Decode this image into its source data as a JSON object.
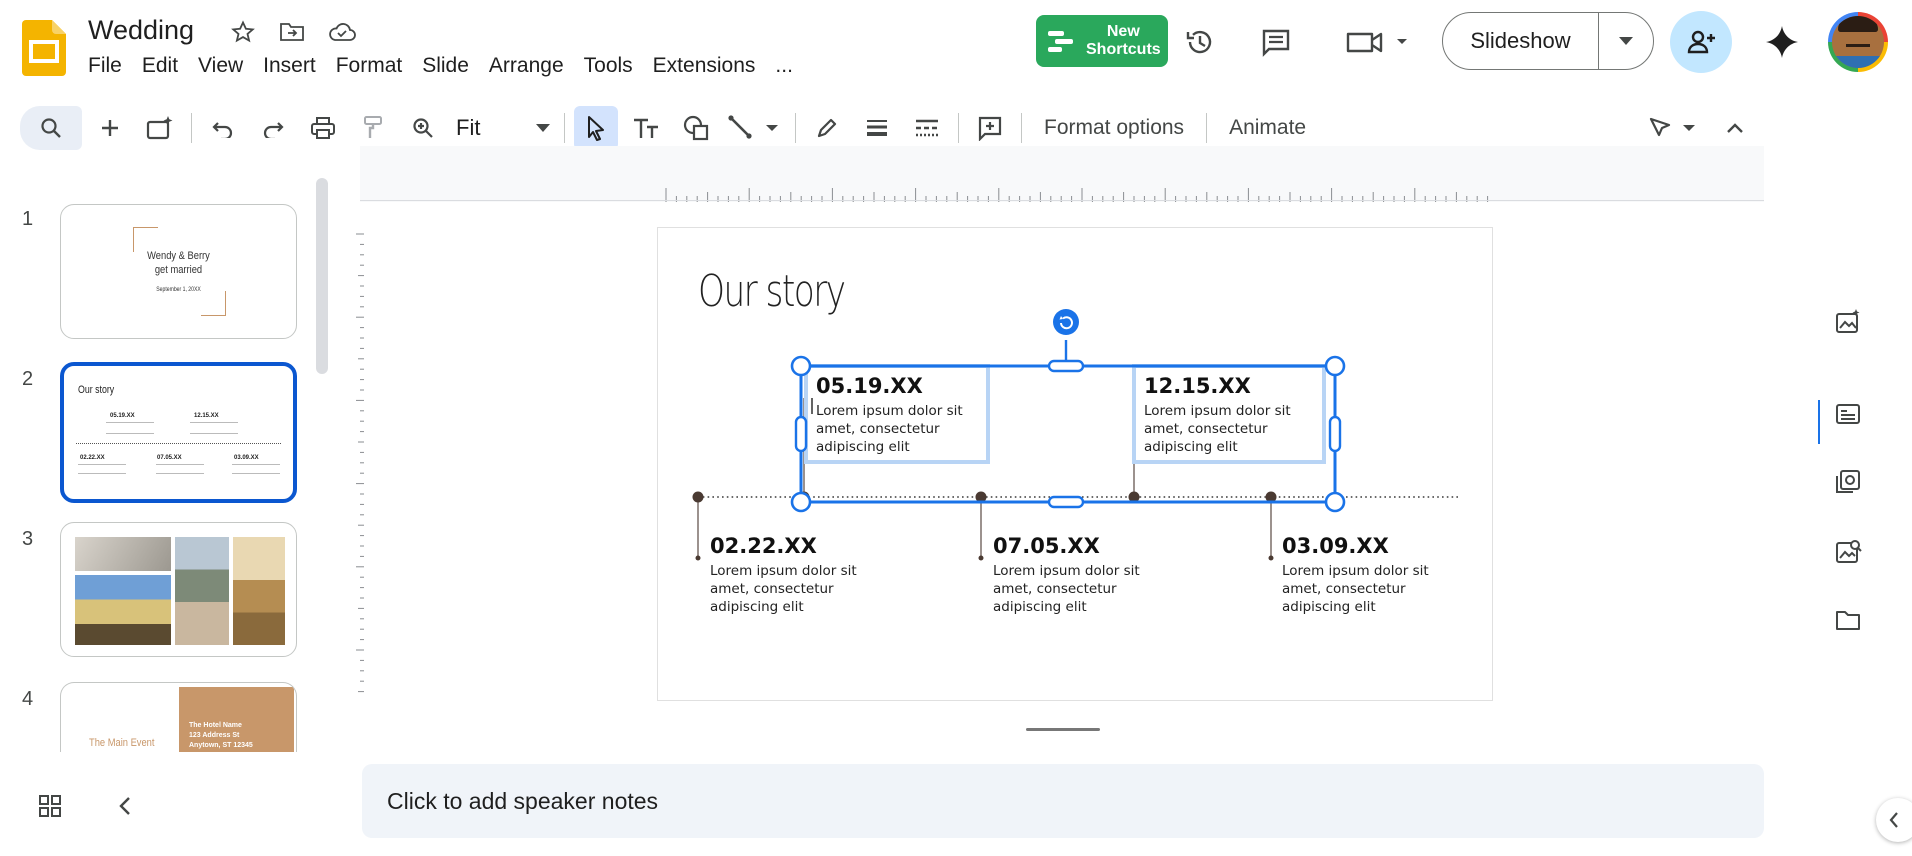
{
  "app": {
    "title": "Wedding"
  },
  "menu": [
    "File",
    "Edit",
    "View",
    "Insert",
    "Format",
    "Slide",
    "Arrange",
    "Tools",
    "Extensions",
    "..."
  ],
  "header": {
    "new_shortcuts": [
      "New",
      "Shortcuts"
    ],
    "slideshow_label": "Slideshow"
  },
  "toolbar": {
    "zoom_value": "Fit",
    "format_options": "Format options",
    "animate": "Animate"
  },
  "filmstrip": {
    "slides": [
      {
        "number": "1",
        "title_lines": [
          "Wendy & Berry",
          "get married"
        ],
        "subtitle": "September 1, 20XX"
      },
      {
        "number": "2",
        "title": "Our story",
        "selected": true,
        "dates": [
          "05.19.XX",
          "12.15.XX",
          "02.22.XX",
          "07.05.XX",
          "03.09.XX"
        ]
      },
      {
        "number": "3"
      },
      {
        "number": "4",
        "left_text": "The Main Event",
        "right_lines": [
          "The Hotel Name",
          "123 Address St",
          "Anytown, ST 12345"
        ]
      }
    ]
  },
  "slide": {
    "title": "Our story",
    "events_top": [
      {
        "date": "05.19.XX",
        "body": "Lorem ipsum dolor sit amet, consectetur adipiscing elit"
      },
      {
        "date": "12.15.XX",
        "body": "Lorem ipsum dolor sit amet, consectetur adipiscing elit"
      }
    ],
    "events_bottom": [
      {
        "date": "02.22.XX",
        "body": "Lorem ipsum dolor sit amet, consectetur adipiscing elit"
      },
      {
        "date": "07.05.XX",
        "body": "Lorem ipsum dolor sit amet, consectetur adipiscing elit"
      },
      {
        "date": "03.09.XX",
        "body": "Lorem ipsum dolor sit amet, consectetur adipiscing elit"
      }
    ]
  },
  "notes": {
    "placeholder": "Click to add speaker notes"
  },
  "colors": {
    "selection": "#1a73e8",
    "brand_yellow": "#f4b400",
    "shortcut_green": "#2aa85c",
    "accent_thumb": "#c8976a"
  }
}
